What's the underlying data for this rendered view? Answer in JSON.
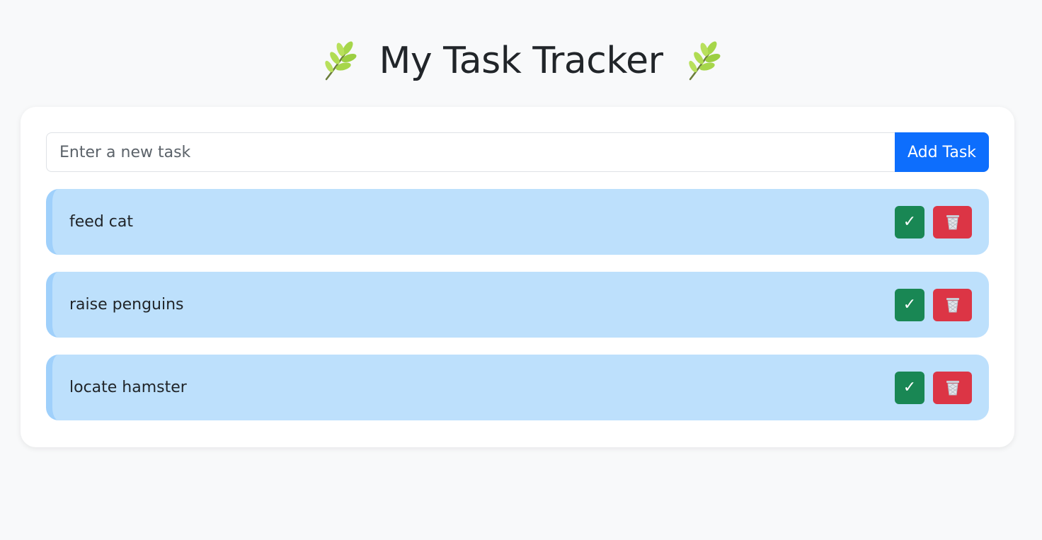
{
  "header": {
    "title": "My Task Tracker",
    "left_icon": "herb-icon",
    "right_icon": "herb-icon"
  },
  "new_task": {
    "placeholder": "Enter a new task",
    "value": "",
    "add_label": "Add Task"
  },
  "tasks": [
    {
      "text": "feed cat",
      "complete_label": "✓",
      "delete_icon": "wastebasket-icon"
    },
    {
      "text": "raise penguins",
      "complete_label": "✓",
      "delete_icon": "wastebasket-icon"
    },
    {
      "text": "locate hamster",
      "complete_label": "✓",
      "delete_icon": "wastebasket-icon"
    }
  ],
  "colors": {
    "background": "#f8f9fa",
    "card": "#ffffff",
    "primary": "#0d6efd",
    "task_bg": "#bde0fc",
    "task_accent": "#9fd0fb",
    "success": "#198754",
    "danger": "#dc3545"
  }
}
